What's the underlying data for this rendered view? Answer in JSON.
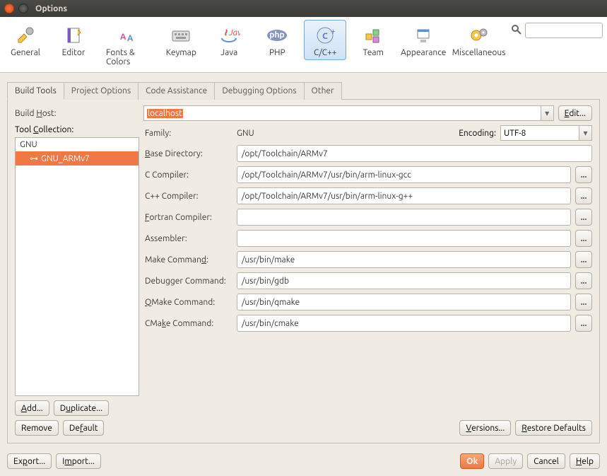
{
  "window": {
    "title": "Options"
  },
  "toolbar": {
    "items": [
      {
        "label": "General"
      },
      {
        "label": "Editor"
      },
      {
        "label": "Fonts & Colors"
      },
      {
        "label": "Keymap"
      },
      {
        "label": "Java"
      },
      {
        "label": "PHP"
      },
      {
        "label": "C/C++"
      },
      {
        "label": "Team"
      },
      {
        "label": "Appearance"
      },
      {
        "label": "Miscellaneous"
      }
    ],
    "search_placeholder": ""
  },
  "tabs": {
    "items": [
      "Build Tools",
      "Project Options",
      "Code Assistance",
      "Debugging Options",
      "Other"
    ]
  },
  "build_host": {
    "label": "Build Host:",
    "label_u": "H",
    "value": "localhost",
    "edit": "Edit..."
  },
  "tool_collection": {
    "label": "Tool Collection:",
    "label_u": "C",
    "items": [
      "GNU",
      "GNU_ARMv7"
    ],
    "selected_index": 1
  },
  "family": {
    "label": "Family:",
    "value": "GNU"
  },
  "encoding": {
    "label": "Encoding:",
    "value": "UTF-8"
  },
  "fields": {
    "base_dir": {
      "label": "Base Directory:",
      "u": "B",
      "value": "/opt/Toolchain/ARMv7",
      "browse": false
    },
    "c_comp": {
      "label": "C Compiler:",
      "value": "/opt/Toolchain/ARMv7/usr/bin/arm-linux-gcc",
      "browse": true
    },
    "cpp_comp": {
      "label": "C++ Compiler:",
      "value": "/opt/Toolchain/ARMv7/usr/bin/arm-linux-g++",
      "browse": true
    },
    "fortran": {
      "label": "Fortran Compiler:",
      "u": "F",
      "value": "",
      "browse": true
    },
    "asm": {
      "label": "Assembler:",
      "value": "",
      "browse": true
    },
    "make": {
      "label": "Make Command:",
      "u": "d",
      "value": "/usr/bin/make",
      "browse": true
    },
    "debugger": {
      "label": "Debugger Command:",
      "value": "/usr/bin/gdb",
      "browse": true
    },
    "qmake": {
      "label": "QMake Command:",
      "u": "Q",
      "value": "/usr/bin/qmake",
      "browse": true
    },
    "cmake": {
      "label": "CMake Command:",
      "u": "k",
      "value": "/usr/bin/cmake",
      "browse": true
    }
  },
  "left_buttons": {
    "add": "Add...",
    "duplicate": "Duplicate...",
    "remove": "Remove",
    "default": "Default"
  },
  "right_buttons": {
    "versions": "Versions...",
    "restore": "Restore Defaults"
  },
  "bottom": {
    "export": "Export...",
    "import": "Import...",
    "ok": "Ok",
    "apply": "Apply",
    "cancel": "Cancel",
    "help": "Help"
  }
}
